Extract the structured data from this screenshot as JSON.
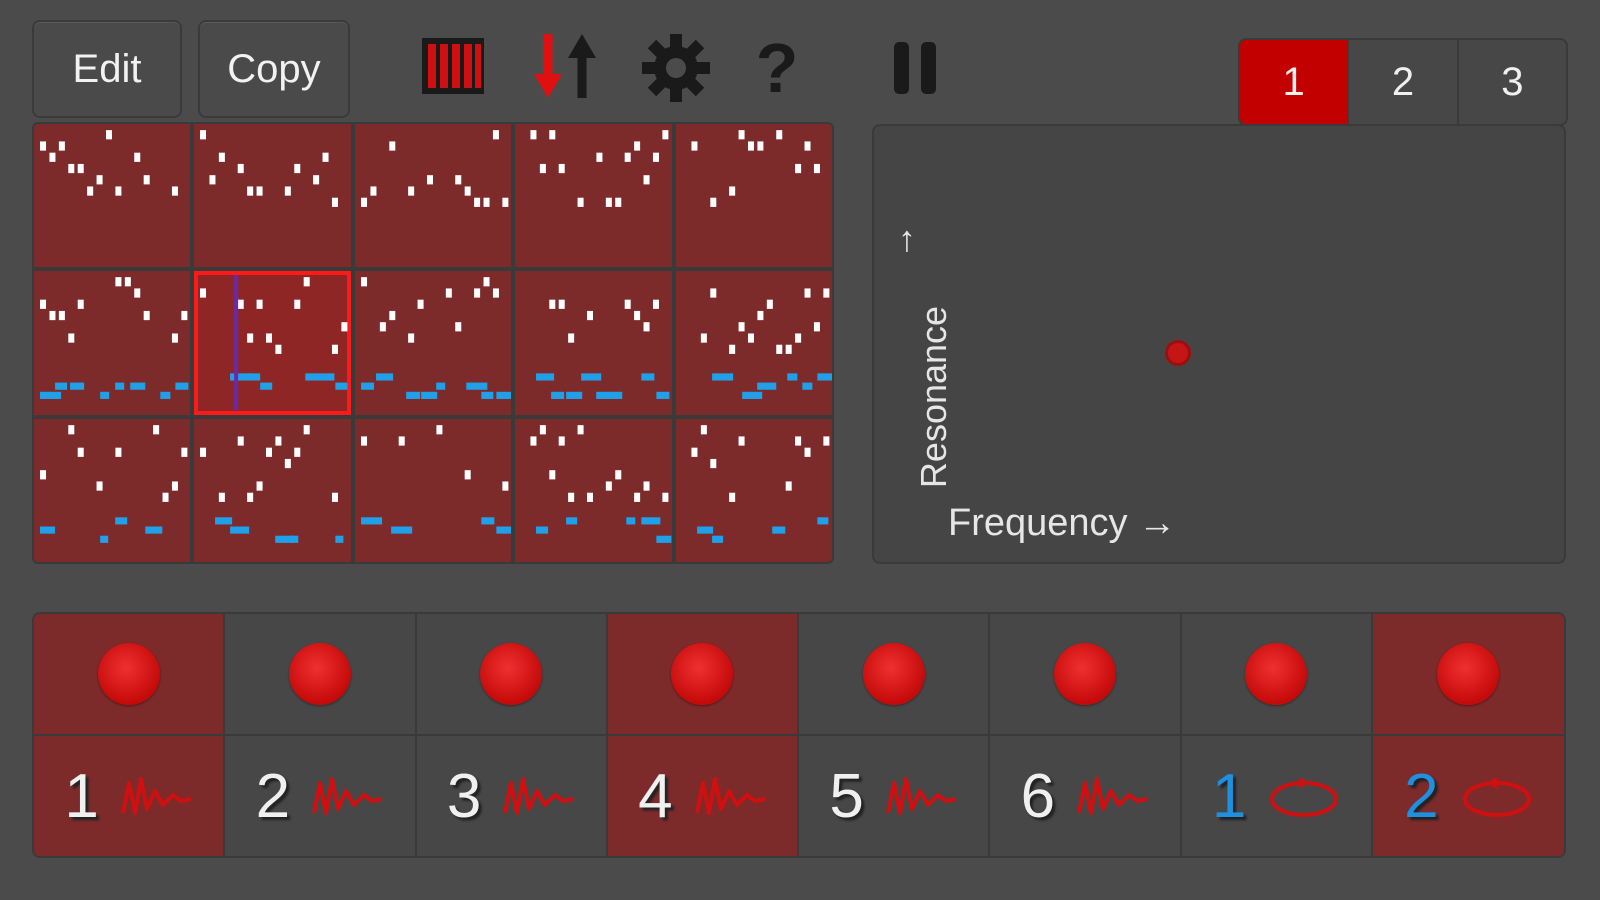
{
  "toolbar": {
    "edit_label": "Edit",
    "copy_label": "Copy",
    "help_label": "?"
  },
  "tabs": [
    {
      "label": "1",
      "active": true
    },
    {
      "label": "2",
      "active": false
    },
    {
      "label": "3",
      "active": false
    }
  ],
  "pattern_grid": {
    "rows": 3,
    "cols": 5,
    "selected_index": 6
  },
  "xy_pad": {
    "y_label": "Resonance",
    "y_arrow": "↑",
    "x_label": "Frequency →",
    "point_frequency": 0.44,
    "point_resonance": 0.48
  },
  "pads": [
    {
      "label": "1",
      "on": true,
      "type": "wave",
      "color": "white"
    },
    {
      "label": "2",
      "on": false,
      "type": "wave",
      "color": "white"
    },
    {
      "label": "3",
      "on": false,
      "type": "wave",
      "color": "white"
    },
    {
      "label": "4",
      "on": true,
      "type": "wave",
      "color": "white"
    },
    {
      "label": "5",
      "on": false,
      "type": "wave",
      "color": "white"
    },
    {
      "label": "6",
      "on": false,
      "type": "wave",
      "color": "white"
    },
    {
      "label": "1",
      "on": false,
      "type": "loop",
      "color": "blue"
    },
    {
      "label": "2",
      "on": true,
      "type": "loop",
      "color": "blue"
    }
  ],
  "colors": {
    "accent": "#c20000",
    "cell": "#7c2a2a",
    "note_white": "#ffffff",
    "note_blue": "#1fa0e8"
  }
}
